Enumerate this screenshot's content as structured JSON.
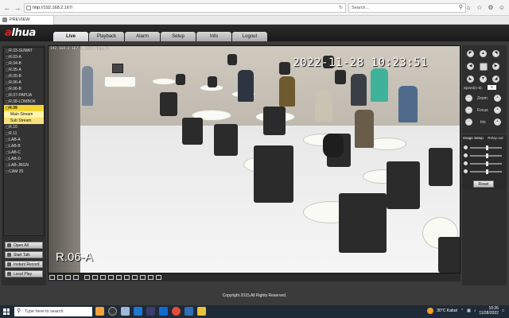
{
  "browser": {
    "url": "http://192.168.2.167/",
    "search_placeholder": "Search...",
    "tab_title": "PREVIEW"
  },
  "app": {
    "logo_prefix": "a",
    "logo_text": "lhua",
    "nav_tabs": [
      "Live",
      "Playback",
      "Alarm",
      "Setup",
      "Info",
      "Logout"
    ],
    "active_tab": "Live"
  },
  "channels": [
    {
      "pfx": "▢",
      "label": "R.03-SUMAT"
    },
    {
      "pfx": "▢",
      "label": "R.03-A"
    },
    {
      "pfx": "▢",
      "label": "R.04-B"
    },
    {
      "pfx": "▢",
      "label": "R.05-A"
    },
    {
      "pfx": "▢",
      "label": "R.05-B"
    },
    {
      "pfx": "▢",
      "label": "R.06-A"
    },
    {
      "pfx": "▢",
      "label": "R.06-B"
    },
    {
      "pfx": "▢",
      "label": "R.07-PAPUA"
    },
    {
      "pfx": "▢",
      "label": "R.08-LOMBOK"
    },
    {
      "pfx": "▢",
      "label": "R.09",
      "selected": true
    },
    {
      "pfx": "",
      "label": "Main Stream",
      "stream": "main"
    },
    {
      "pfx": "",
      "label": "Sub Stream",
      "stream": "sub"
    },
    {
      "pfx": "▢",
      "label": "R.10"
    },
    {
      "pfx": "▢",
      "label": "R.11"
    },
    {
      "pfx": "▢",
      "label": "LAB-A"
    },
    {
      "pfx": "▢",
      "label": "LAB-B"
    },
    {
      "pfx": "▢",
      "label": "LAB-C"
    },
    {
      "pfx": "▢",
      "label": "LAB-D"
    },
    {
      "pfx": "▢",
      "label": "LAB-JRGN"
    },
    {
      "pfx": "▢",
      "label": "CAM 20"
    }
  ],
  "side_buttons": [
    "Open All",
    "Start Talk",
    "Instant Record",
    "Local Play"
  ],
  "video": {
    "info": "192.168.2.167_9_1920 4bps_H",
    "timestamp": "2022-11-28 10:23:51",
    "camera_label": "R.06-A"
  },
  "ptz": {
    "speed_label": "Speed(1-8):",
    "speed_value": "5",
    "zoom": "Zoom",
    "focus": "Focus",
    "iris": "Iris"
  },
  "image_panel": {
    "tabs": [
      "Image Setup",
      "Relay-out"
    ],
    "active": "Image Setup",
    "reset_label": "Reset",
    "sliders": [
      {
        "icon": "brightness-icon",
        "level": 0.5
      },
      {
        "icon": "contrast-icon",
        "level": 0.5
      },
      {
        "icon": "hue-icon",
        "level": 0.5
      },
      {
        "icon": "saturation-icon",
        "level": 0.5
      }
    ]
  },
  "footer": "Copyright 2015,All Rights Reserved.",
  "taskbar": {
    "search_placeholder": "Type here to search",
    "weather": "30°C  Kabut",
    "time": "10:26",
    "date": "11/28/2022"
  }
}
